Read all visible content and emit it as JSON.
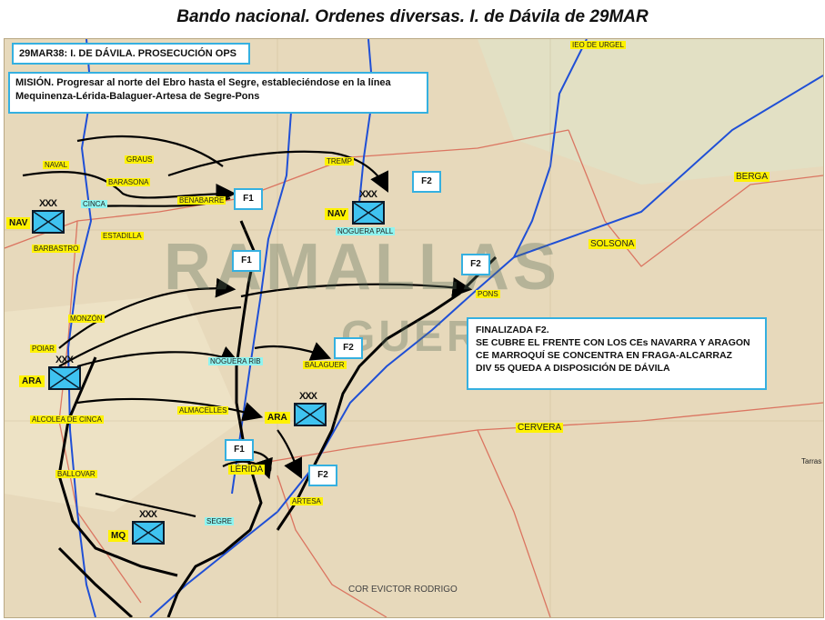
{
  "title": "Bando nacional. Ordenes diversas. I. de Dávila de 29MAR",
  "header": {
    "text": "29MAR38: I. DE DÁVILA. PROSECUCIÓN OPS"
  },
  "mission": {
    "line1": "MISIÓN. Progresar al norte del Ebro hasta el Segre, estableciéndose en la línea",
    "line2": "Mequinenza-Lérida-Balaguer-Artesa de Segre-Pons"
  },
  "status": {
    "line1": "FINALIZADA  F2.",
    "line2": "SE CUBRE EL FRENTE CON LOS CEs  NAVARRA Y ARAGON",
    "line3": "CE MARROQUÍ SE CONCENTRA EN  FRAGA-ALCARRAZ",
    "line4": "DIV 55 QUEDA A DISPOSICIÓN DE DÁVILA"
  },
  "phases": {
    "f1_benabarre": "F1",
    "f1_center": "F1",
    "f1_lerida": "F1",
    "f2_tremp": "F2",
    "f2_pons": "F2",
    "f2_balaguer": "F2",
    "f2_artesa": "F2"
  },
  "units": {
    "nav_west": {
      "label": "NAV",
      "echelon": "XXX"
    },
    "nav_east": {
      "label": "NAV",
      "echelon": "XXX"
    },
    "ara_west": {
      "label": "ARA",
      "echelon": "XXX"
    },
    "ara_east": {
      "label": "ARA",
      "echelon": "XXX"
    },
    "mq": {
      "label": "MQ",
      "echelon": "XXX"
    }
  },
  "places": {
    "seo_urgel": "IEO DE URGEL",
    "berga": "BERGA",
    "solsona": "SOLSONA",
    "naval": "NAVAL",
    "graus": "GRAUS",
    "barasona": "BARASONA",
    "benabarre": "BENABARRE",
    "tremp": "TREMP",
    "noguera_pall": "NOGUERA PALL",
    "barbastro": "BARBASTRO",
    "estadilla": "ESTADILLA",
    "cinca": "CINCA",
    "monzon": "MONZÓN",
    "pons": "PONS",
    "noguera_rib": "NOGUERA RIB",
    "balaguer": "BALAGUER",
    "cervera": "CERVERA",
    "lerida": "LÉRIDA",
    "artesa": "ARTESA",
    "segre": "SEGRE",
    "almacelles": "ALMACELLES",
    "alcolea": "ALCOLEA DE CINCA",
    "poiar": "POIAR",
    "ballobar": "BALLOVAR",
    "tarrasa": "Tarras"
  },
  "watermark": {
    "line1": "RAMALLAS",
    "line2": "GUERRA"
  },
  "credit": "COR EVICTOR RODRIGO",
  "colors": {
    "river": "#1f4fd6",
    "front": "#000000",
    "highlight": "#fff200",
    "box_border": "#35b0e0",
    "unit_fill": "#3fc3f0"
  }
}
